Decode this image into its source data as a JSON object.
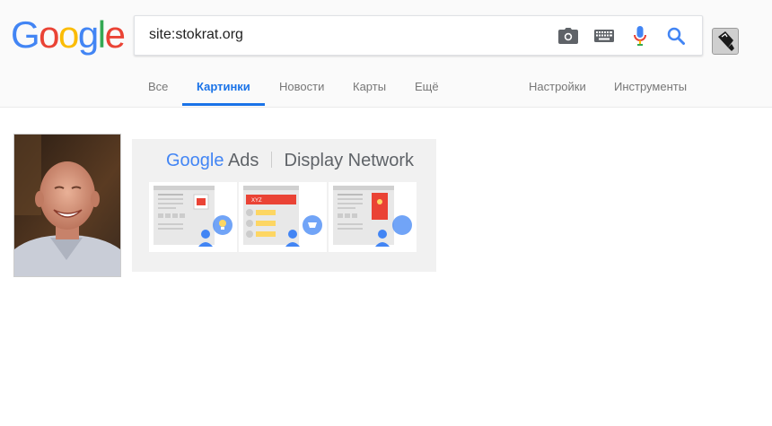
{
  "logo": {
    "letters": [
      "G",
      "o",
      "o",
      "g",
      "l",
      "e"
    ],
    "colors": [
      "#4285F4",
      "#EA4335",
      "#FBBC05",
      "#4285F4",
      "#34A853",
      "#EA4335"
    ]
  },
  "search": {
    "query": "site:stokrat.org"
  },
  "icons": {
    "camera": "camera-icon",
    "keyboard": "keyboard-icon",
    "mic": "microphone-icon",
    "search": "search-icon"
  },
  "tabs": [
    {
      "label": "Все"
    },
    {
      "label": "Картинки",
      "active": true
    },
    {
      "label": "Новости"
    },
    {
      "label": "Карты"
    },
    {
      "label": "Ещё"
    }
  ],
  "tools": {
    "settings": "Настройки",
    "instruments": "Инструменты"
  },
  "results": {
    "ad": {
      "brand": "Google",
      "product": "Ads",
      "network": "Display Network",
      "badge": "XYZ"
    }
  },
  "colors": {
    "accent": "#1a73e8",
    "text_muted": "#777777"
  }
}
